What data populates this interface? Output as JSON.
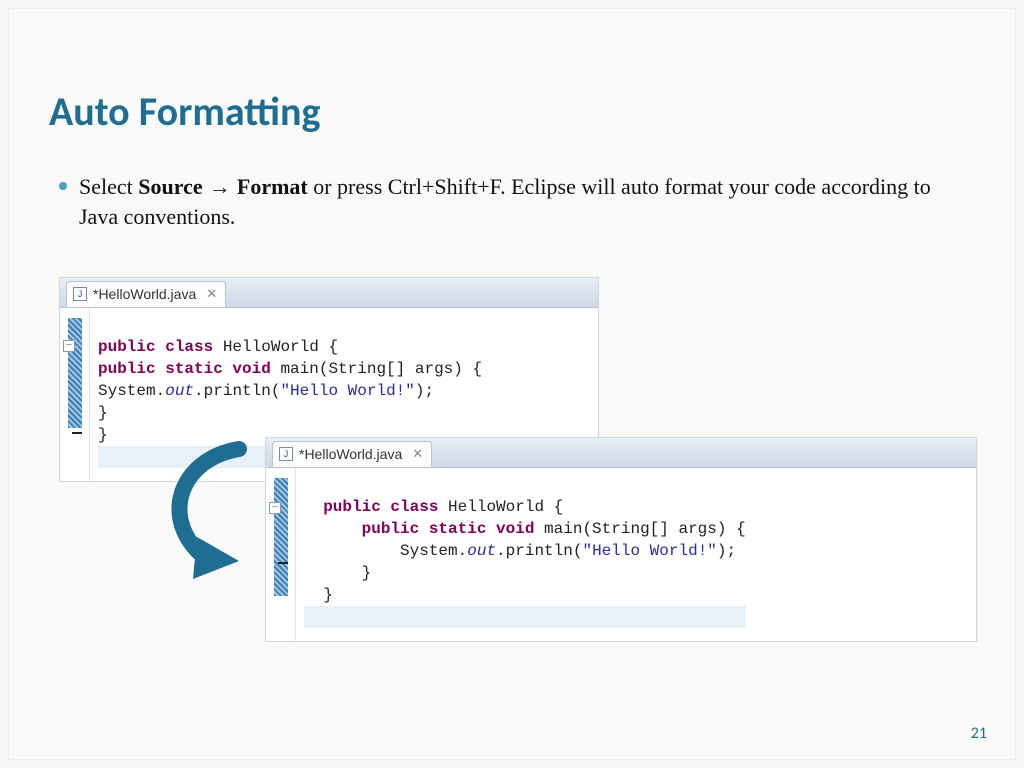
{
  "title": "Auto Formatting",
  "bullet": {
    "pre": "Select ",
    "strong1": "Source",
    "arrow": " → ",
    "strong2": "Format",
    "post": " or press Ctrl+Shift+F. Eclipse will auto format your code according to Java conventions."
  },
  "editor1": {
    "tab": "*HelloWorld.java",
    "lines": {
      "l1_kw": "public class ",
      "l1_rest": "HelloWorld {",
      "l2_kw": "public static void ",
      "l2_m": "main",
      "l2_rest": "(String[] args) {",
      "l3_a": "System.",
      "l3_out": "out",
      "l3_b": ".println(",
      "l3_str": "\"Hello World!\"",
      "l3_c": ");",
      "l4": "}",
      "l5": "}"
    }
  },
  "editor2": {
    "tab": "*HelloWorld.java",
    "lines": {
      "l1_kw": "public class ",
      "l1_rest": "HelloWorld {",
      "l2_kw": "public static void ",
      "l2_m": "main",
      "l2_rest": "(String[] args) {",
      "l3_a": "System.",
      "l3_out": "out",
      "l3_b": ".println(",
      "l3_str": "\"Hello World!\"",
      "l3_c": ");",
      "l4": "}",
      "l5": "}"
    }
  },
  "page": "21",
  "icons": {
    "file_letter": "J",
    "close": "✕",
    "fold": "−"
  }
}
